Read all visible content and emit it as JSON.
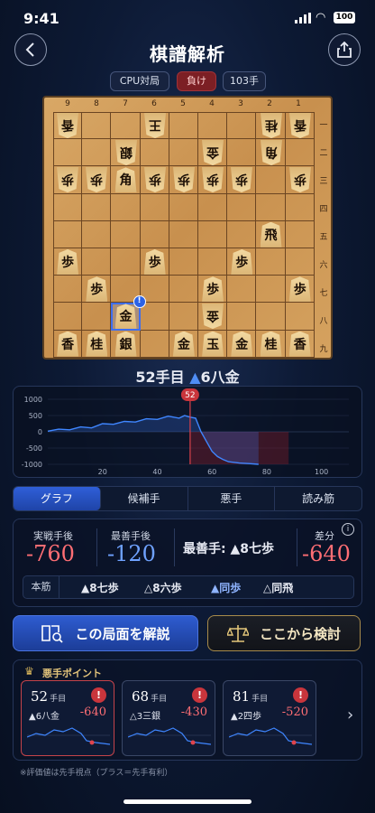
{
  "status": {
    "time": "9:41",
    "battery": "100"
  },
  "header": {
    "title": "棋譜解析",
    "back_icon": "chevron-left-icon",
    "share_icon": "share-icon"
  },
  "game_tags": {
    "mode": "CPU対局",
    "result": "負け",
    "moves": "103手"
  },
  "board": {
    "col_numbers": [
      "9",
      "8",
      "7",
      "6",
      "5",
      "4",
      "3",
      "2",
      "1"
    ],
    "row_numbers": [
      "一",
      "二",
      "三",
      "四",
      "五",
      "六",
      "七",
      "八",
      "九"
    ],
    "pieces": [
      {
        "c": 9,
        "r": 1,
        "k": "香",
        "g": true
      },
      {
        "c": 6,
        "r": 1,
        "k": "王",
        "g": true
      },
      {
        "c": 2,
        "r": 1,
        "k": "桂",
        "g": true
      },
      {
        "c": 1,
        "r": 1,
        "k": "香",
        "g": true
      },
      {
        "c": 7,
        "r": 2,
        "k": "銀",
        "g": true
      },
      {
        "c": 4,
        "r": 2,
        "k": "金",
        "g": true
      },
      {
        "c": 2,
        "r": 2,
        "k": "角",
        "g": true
      },
      {
        "c": 9,
        "r": 3,
        "k": "歩",
        "g": true
      },
      {
        "c": 8,
        "r": 3,
        "k": "歩",
        "g": true
      },
      {
        "c": 7,
        "r": 3,
        "k": "角",
        "g": false
      },
      {
        "c": 6,
        "r": 3,
        "k": "歩",
        "g": true
      },
      {
        "c": 5,
        "r": 3,
        "k": "歩",
        "g": true
      },
      {
        "c": 4,
        "r": 3,
        "k": "歩",
        "g": true
      },
      {
        "c": 3,
        "r": 3,
        "k": "歩",
        "g": true
      },
      {
        "c": 1,
        "r": 3,
        "k": "歩",
        "g": true
      },
      {
        "c": 2,
        "r": 5,
        "k": "飛",
        "g": false
      },
      {
        "c": 9,
        "r": 6,
        "k": "歩",
        "g": false
      },
      {
        "c": 6,
        "r": 6,
        "k": "歩",
        "g": false
      },
      {
        "c": 3,
        "r": 6,
        "k": "歩",
        "g": false
      },
      {
        "c": 8,
        "r": 7,
        "k": "歩",
        "g": false
      },
      {
        "c": 4,
        "r": 7,
        "k": "歩",
        "g": false
      },
      {
        "c": 1,
        "r": 7,
        "k": "歩",
        "g": false
      },
      {
        "c": 7,
        "r": 8,
        "k": "金",
        "g": false
      },
      {
        "c": 4,
        "r": 8,
        "k": "金",
        "g": true
      },
      {
        "c": 9,
        "r": 9,
        "k": "香",
        "g": false
      },
      {
        "c": 8,
        "r": 9,
        "k": "桂",
        "g": false
      },
      {
        "c": 7,
        "r": 9,
        "k": "銀",
        "g": false
      },
      {
        "c": 5,
        "r": 9,
        "k": "金",
        "g": false
      },
      {
        "c": 4,
        "r": 9,
        "k": "玉",
        "g": false
      },
      {
        "c": 3,
        "r": 9,
        "k": "金",
        "g": false
      },
      {
        "c": 2,
        "r": 9,
        "k": "桂",
        "g": false
      },
      {
        "c": 1,
        "r": 9,
        "k": "香",
        "g": false
      }
    ],
    "highlight": {
      "c": 7,
      "r": 8
    },
    "badge": "!"
  },
  "move_label": {
    "number": "52手目",
    "triangle": "▲",
    "move": "6八金"
  },
  "chart_data": {
    "type": "line",
    "x": [
      0,
      4,
      8,
      12,
      16,
      20,
      24,
      28,
      32,
      36,
      40,
      44,
      48,
      50,
      52,
      54,
      56,
      58,
      60,
      62,
      64,
      66,
      70,
      74,
      77
    ],
    "values": [
      20,
      80,
      60,
      150,
      120,
      250,
      230,
      320,
      300,
      400,
      380,
      480,
      420,
      500,
      450,
      420,
      0,
      -300,
      -600,
      -760,
      -850,
      -920,
      -960,
      -980,
      -1000
    ],
    "yticks": [
      "1000",
      "500",
      "0",
      "-500",
      "-1000"
    ],
    "xticks": [
      "20",
      "40",
      "60",
      "80",
      "100"
    ],
    "ylim": [
      -1000,
      1000
    ],
    "xlim": [
      0,
      110
    ],
    "marker": "52",
    "marker_x": 52
  },
  "tabs": [
    "グラフ",
    "候補手",
    "悪手",
    "読み筋"
  ],
  "eval": {
    "actual_label": "実戦手後",
    "actual_value": "-760",
    "best_label": "最善手後",
    "best_value": "-120",
    "best_move_label": "最善手: ▲8七歩",
    "diff_label": "差分",
    "diff_value": "-640",
    "info_icon": "info-icon",
    "honsuji_label": "本筋",
    "honsuji_moves": [
      "▲8七歩",
      "△8六歩",
      "▲同歩",
      "△同飛"
    ]
  },
  "actions": {
    "explain": "この局面を解説",
    "study": "ここから検討",
    "explain_icon": "book-search-icon",
    "study_icon": "scale-icon"
  },
  "mistakes": {
    "title": "悪手ポイント",
    "crown_icon": "crown-icon",
    "cards": [
      {
        "num": "52",
        "unit": "手目",
        "move": "▲6八金",
        "diff": "-640",
        "selected": true
      },
      {
        "num": "68",
        "unit": "手目",
        "move": "△3三銀",
        "diff": "-430",
        "selected": false
      },
      {
        "num": "81",
        "unit": "手目",
        "move": "▲2四歩",
        "diff": "-520",
        "selected": false
      }
    ]
  },
  "footnote": "※評価値は先手視点（プラス＝先手有利）",
  "colors": {
    "accent": "#2f5fd8",
    "bad": "#ff6e74",
    "gold": "#c9a455",
    "best": "#6fa2ff"
  }
}
